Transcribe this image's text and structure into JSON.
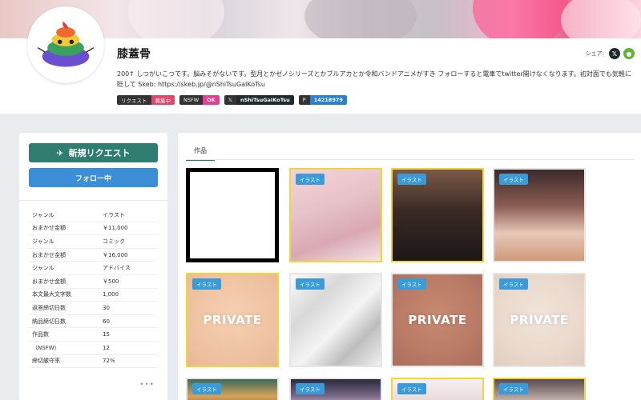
{
  "profile": {
    "name": "膝蓋骨",
    "share_label": "シェア:",
    "share_x_icon": "x-logo-icon",
    "share_line_icon": "line-logo-icon",
    "bio": "200↑ しつがいこつです。脳みそがないです。型月とかゼノシリーズとかブルアカとか令和バンドアニメがすき フォローすると電車でtwitter開けなくなります。初対面でも気軽に 眨して Skeb: https://skeb.jp/@nShiTsuGaIKoTsu",
    "badges": {
      "request_label": "リクエスト",
      "request_status": "募集中",
      "nsfw_label": "NSFW",
      "nsfw_status": "OK",
      "x_handle": "nShiTsuGaIKoTsu",
      "pixiv_id": "14218979"
    }
  },
  "sidebar": {
    "new_request_label": "新規リクエスト",
    "follow_label": "フォロー中",
    "stats": [
      {
        "key": "ジャンル",
        "value": "イラスト"
      },
      {
        "key": "おまかせ金額",
        "value": "￥11,000"
      },
      {
        "key": "ジャンル",
        "value": "コミック"
      },
      {
        "key": "おまかせ金額",
        "value": "￥16,000"
      },
      {
        "key": "ジャンル",
        "value": "アドバイス"
      },
      {
        "key": "おまかせ金額",
        "value": "￥500"
      },
      {
        "key": "本文最大文字数",
        "value": "1,000"
      },
      {
        "key": "返答締切日数",
        "value": "30"
      },
      {
        "key": "納品締切日数",
        "value": "60"
      },
      {
        "key": "作品数",
        "value": "15"
      },
      {
        "key": "（NSFW）",
        "value": "12"
      },
      {
        "key": "締切厳守率",
        "value": "72%"
      }
    ],
    "more": "•••"
  },
  "main": {
    "tab_works": "作品",
    "tag_illust": "イラスト",
    "private_label": "PRIVATE"
  },
  "colors": {
    "accent_green": "#2e7d6f",
    "follow_blue": "#3b8fd9",
    "tag_blue": "#3b9bd9",
    "highlight_yellow": "#f2d53c"
  }
}
